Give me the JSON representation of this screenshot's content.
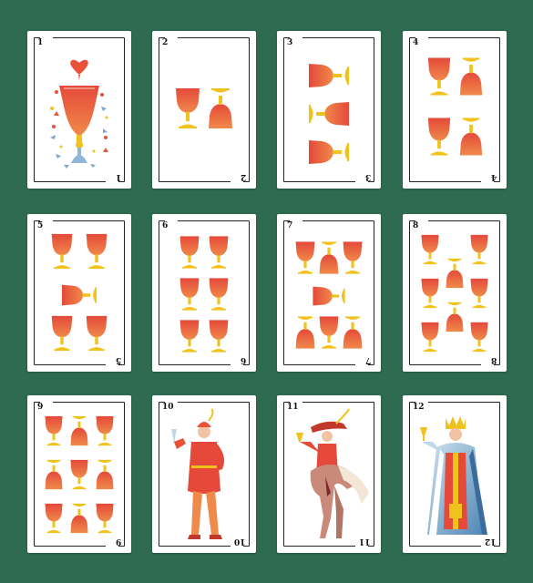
{
  "deck": {
    "suit": "cups",
    "card_color": "#ffffff",
    "table_color": "#2f6b50",
    "cup_color": "#e8513a",
    "stem_color": "#f1c21b",
    "cards": [
      {
        "rank": "1",
        "index": "1",
        "figure": "ace-of-cups-icon"
      },
      {
        "rank": "2",
        "index": "2",
        "figure": "two-cups-icon"
      },
      {
        "rank": "3",
        "index": "3",
        "figure": "three-cups-icon"
      },
      {
        "rank": "4",
        "index": "4",
        "figure": "four-cups-icon"
      },
      {
        "rank": "5",
        "index": "5",
        "figure": "five-cups-icon"
      },
      {
        "rank": "6",
        "index": "6",
        "figure": "six-cups-icon"
      },
      {
        "rank": "7",
        "index": "7",
        "figure": "seven-cups-icon"
      },
      {
        "rank": "8",
        "index": "8",
        "figure": "eight-cups-icon"
      },
      {
        "rank": "9",
        "index": "9",
        "figure": "nine-cups-icon"
      },
      {
        "rank": "10",
        "index": "10",
        "figure": "page-figure-icon"
      },
      {
        "rank": "11",
        "index": "11",
        "figure": "knight-on-horse-icon"
      },
      {
        "rank": "12",
        "index": "12",
        "figure": "king-figure-icon"
      }
    ]
  }
}
